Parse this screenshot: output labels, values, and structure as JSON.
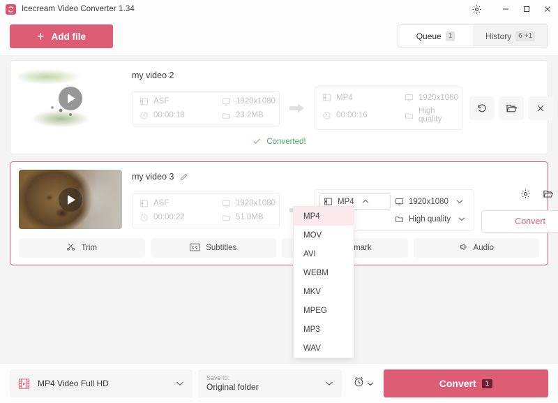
{
  "window": {
    "title": "Icecream Video Converter 1.34",
    "logo_icon": "icecream-logo-icon",
    "controls": {
      "settings": "gear-icon",
      "minimize": "minimize-icon",
      "maximize": "maximize-icon",
      "close": "close-icon"
    }
  },
  "toolbar": {
    "add_file_label": "Add file",
    "add_file_icon": "plus-icon",
    "tabs": [
      {
        "label": "Queue",
        "badge": "1",
        "active": true
      },
      {
        "label": "History",
        "badge": "6 +1",
        "active": false
      }
    ]
  },
  "colors": {
    "accent": "#dd5d77",
    "accent_dark": "#6f2030",
    "success": "#4aa564",
    "dropdown_selected_bg": "#fbe9ec"
  },
  "cards": [
    {
      "name": "my video 2",
      "thumbnail": "cheetah-thumbnail",
      "play_icon": "play-icon",
      "source": {
        "format": "ASF",
        "format_icon": "film-icon",
        "resolution": "1920x1080",
        "resolution_icon": "monitor-icon",
        "duration": "00:00:18",
        "duration_icon": "clock-icon",
        "size": "23.2MB",
        "size_icon": "folder-icon"
      },
      "arrow_icon": "arrow-right-icon",
      "target": {
        "format": "MP4",
        "format_icon": "film-icon",
        "resolution": "1920x1080",
        "resolution_icon": "monitor-icon",
        "duration": "00:00:16",
        "duration_icon": "clock-icon",
        "quality": "High quality",
        "quality_icon": "folder-icon"
      },
      "actions": [
        {
          "name": "restore-button",
          "icon": "undo-icon"
        },
        {
          "name": "open-folder-button",
          "icon": "folder-open-icon"
        },
        {
          "name": "remove-button",
          "icon": "close-icon"
        }
      ],
      "status": {
        "text": "Converted!",
        "icon": "check-icon"
      }
    },
    {
      "name": "my video 3",
      "edit_icon": "pencil-icon",
      "thumbnail": "lion-thumbnail",
      "play_icon": "play-icon",
      "source": {
        "format": "ASF",
        "format_icon": "film-icon",
        "resolution": "1920x1080",
        "resolution_icon": "monitor-icon",
        "duration": "00:00:22",
        "duration_icon": "clock-icon",
        "size": "51.0MB",
        "size_icon": "folder-icon"
      },
      "arrow_icon": "arrow-right-icon",
      "selectors": {
        "format": {
          "value": "MP4",
          "icon": "film-icon",
          "chevron": "chevron-up-icon",
          "open": true
        },
        "resolution": {
          "value": "1920x1080",
          "icon": "monitor-icon",
          "chevron": "chevron-down-icon"
        },
        "quality": {
          "value": "High quality",
          "icon": "folder-icon",
          "chevron": "chevron-down-icon"
        }
      },
      "actions": [
        {
          "name": "settings-button",
          "icon": "gear-icon"
        },
        {
          "name": "open-folder-button",
          "icon": "folder-open-icon"
        },
        {
          "name": "remove-button",
          "icon": "close-icon"
        }
      ],
      "convert_label": "Convert",
      "tools": [
        {
          "label": "Trim",
          "icon": "scissors-icon"
        },
        {
          "label": "Subtitles",
          "icon": "cc-icon"
        },
        {
          "label": "Watermark",
          "icon": "watermark-icon"
        },
        {
          "label": "Audio",
          "icon": "audio-icon"
        }
      ]
    }
  ],
  "format_dropdown": {
    "open": true,
    "selected": "MP4",
    "options": [
      "MP4",
      "MOV",
      "AVI",
      "WEBM",
      "MKV",
      "MPEG",
      "MP3",
      "WAV"
    ]
  },
  "bottom_bar": {
    "format_preset": {
      "value": "MP4 Video Full HD",
      "icon": "film-icon",
      "chevron": "chevron-down-icon"
    },
    "save_to": {
      "label": "Save to:",
      "value": "Original folder",
      "chevron": "chevron-down-icon"
    },
    "timer": {
      "icon": "alarm-clock-icon",
      "chevron": "chevron-down-icon"
    },
    "convert": {
      "label": "Convert",
      "badge": "1"
    }
  }
}
